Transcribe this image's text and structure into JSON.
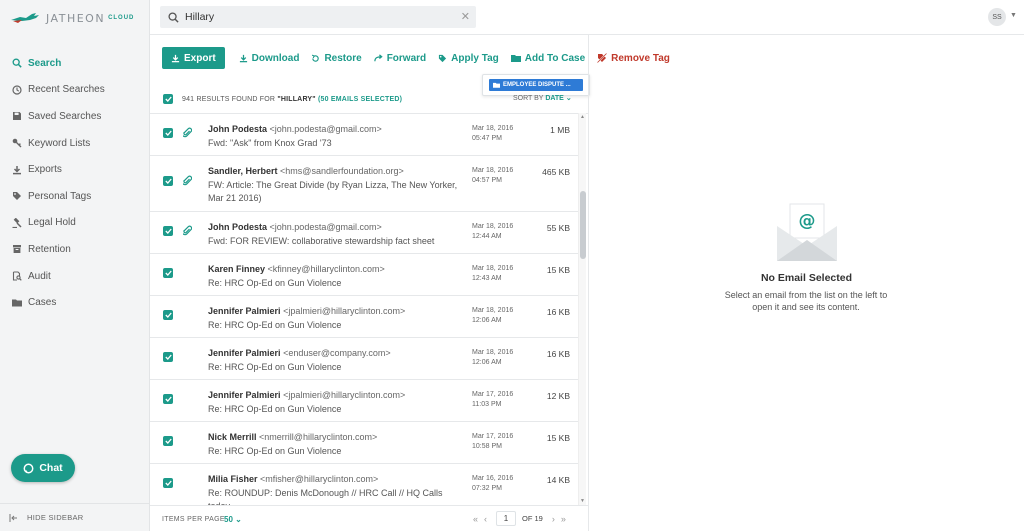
{
  "app": {
    "logo_text": "JATHEON",
    "logo_sub": "CLOUD"
  },
  "search": {
    "value": "Hillary",
    "placeholder": "Search"
  },
  "user": {
    "initials": "SS"
  },
  "sidebar": {
    "items": [
      {
        "label": "Search",
        "icon": "search-icon"
      },
      {
        "label": "Recent Searches",
        "icon": "history-icon"
      },
      {
        "label": "Saved Searches",
        "icon": "save-icon"
      },
      {
        "label": "Keyword Lists",
        "icon": "key-icon"
      },
      {
        "label": "Exports",
        "icon": "export-icon"
      },
      {
        "label": "Personal Tags",
        "icon": "tag-icon"
      },
      {
        "label": "Legal Hold",
        "icon": "gavel-icon"
      },
      {
        "label": "Retention",
        "icon": "archive-icon"
      },
      {
        "label": "Audit",
        "icon": "audit-icon"
      },
      {
        "label": "Cases",
        "icon": "folder-icon"
      }
    ],
    "chat_label": "Chat",
    "hide_label": "HIDE SIDEBAR"
  },
  "toolbar": {
    "export": "Export",
    "download": "Download",
    "restore": "Restore",
    "forward": "Forward",
    "apply_tag": "Apply Tag",
    "add_to_case": "Add To Case",
    "remove_tag": "Remove Tag",
    "case_chip": "EMPLOYEE DISPUTE ..."
  },
  "results": {
    "count": "941",
    "found_text": "RESULTS FOUND FOR",
    "query": "\"HILLARY\"",
    "selected": "(50 EMAILS SELECTED)",
    "sort_label": "SORT BY",
    "sort_value": "DATE"
  },
  "emails": [
    {
      "name": "John Podesta",
      "addr": "<john.podesta@gmail.com>",
      "subject": "Fwd: \"Ask\" from Knox Grad '73",
      "date": "Mar 18, 2016",
      "time": "05:47 PM",
      "size": "1 MB",
      "attachment": true
    },
    {
      "name": "Sandler, Herbert",
      "addr": "<hms@sandlerfoundation.org>",
      "subject": "FW: Article: The Great Divide (by Ryan Lizza, The New Yorker, Mar 21 2016)",
      "date": "Mar 18, 2016",
      "time": "04:57 PM",
      "size": "465 KB",
      "attachment": true
    },
    {
      "name": "John Podesta",
      "addr": "<john.podesta@gmail.com>",
      "subject": "Fwd: FOR REVIEW: collaborative stewardship fact sheet",
      "date": "Mar 18, 2016",
      "time": "12:44 AM",
      "size": "55 KB",
      "attachment": true
    },
    {
      "name": "Karen Finney",
      "addr": "<kfinney@hillaryclinton.com>",
      "subject": "Re: HRC Op-Ed on Gun Violence",
      "date": "Mar 18, 2016",
      "time": "12:43 AM",
      "size": "15 KB",
      "attachment": false
    },
    {
      "name": "Jennifer Palmieri",
      "addr": "<jpalmieri@hillaryclinton.com>",
      "subject": "Re: HRC Op-Ed on Gun Violence",
      "date": "Mar 18, 2016",
      "time": "12:06 AM",
      "size": "16 KB",
      "attachment": false
    },
    {
      "name": "Jennifer Palmieri",
      "addr": "<enduser@company.com>",
      "subject": "Re: HRC Op-Ed on Gun Violence",
      "date": "Mar 18, 2016",
      "time": "12:06 AM",
      "size": "16 KB",
      "attachment": false
    },
    {
      "name": "Jennifer Palmieri",
      "addr": "<jpalmieri@hillaryclinton.com>",
      "subject": "Re: HRC Op-Ed on Gun Violence",
      "date": "Mar 17, 2016",
      "time": "11:03 PM",
      "size": "12 KB",
      "attachment": false
    },
    {
      "name": "Nick Merrill",
      "addr": "<nmerrill@hillaryclinton.com>",
      "subject": "Re: HRC Op-Ed on Gun Violence",
      "date": "Mar 17, 2016",
      "time": "10:58 PM",
      "size": "15 KB",
      "attachment": false
    },
    {
      "name": "Milia Fisher",
      "addr": "<mfisher@hillaryclinton.com>",
      "subject": "Re: ROUNDUP: Denis McDonough // HRC Call // HQ Calls today",
      "date": "Mar 16, 2016",
      "time": "07:32 PM",
      "size": "14 KB",
      "attachment": false
    }
  ],
  "footer": {
    "per_page_label": "ITEMS PER PAGE",
    "per_page_value": "50",
    "page": "1",
    "of_pages": "OF 19"
  },
  "preview": {
    "empty_title": "No Email Selected",
    "empty_text": "Select an email from the list on the left to open it and see its content."
  },
  "colors": {
    "accent": "#1c9a8a",
    "danger": "#c0392b",
    "chip": "#2e7bd6"
  }
}
